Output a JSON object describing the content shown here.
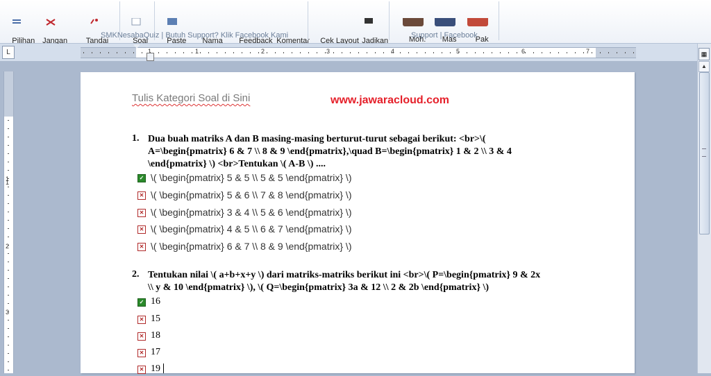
{
  "ribbon": {
    "buttons": [
      {
        "id": "pilihan-ganda",
        "label": "Pilihan\nGanda",
        "icon": "list-icon"
      },
      {
        "id": "jangan-acak-soal",
        "label": "Jangan\nAcak Soal",
        "icon": "no-shuffle-icon"
      },
      {
        "id": "tandai-benar-salah",
        "label": "Tandai\nBenar/Salah",
        "icon": "check-mark-icon"
      },
      {
        "id": "soal-essay",
        "label": "Soal\nEssay",
        "icon": "essay-icon"
      },
      {
        "id": "paste-image",
        "label": "Paste\nImage",
        "icon": "image-icon"
      },
      {
        "id": "nama-pertanyaan",
        "label": "Nama\nPertanyaan",
        "icon": "name-tag-icon"
      },
      {
        "id": "feedback-soal",
        "label": "Feedback\nSoal",
        "icon": "feedback-icon"
      },
      {
        "id": "komentar-soal",
        "label": "Komentar\nSoal",
        "icon": "comment-icon"
      },
      {
        "id": "cek-layout-soal",
        "label": "Cek Layout\nSoal",
        "icon": "layout-check-icon"
      },
      {
        "id": "jadikan-xml",
        "label": "Jadikan\nXML",
        "icon": "xml-icon"
      },
      {
        "id": "moh-shobirin",
        "label": "Moh.\nShobirin",
        "icon": "avatar-icon"
      },
      {
        "id": "mas-pur",
        "label": "Mas\nPur",
        "icon": "avatar-icon"
      },
      {
        "id": "pak-suprino",
        "label": "Pak\nSuprino",
        "icon": "avatar-icon"
      }
    ],
    "group_main_label": "SMKNesabaQuiz | Butuh Support? Klik Facebook Kami",
    "group_support_label": "Support | Facebook"
  },
  "ruler": {
    "tab_selector": "L",
    "h_numbers": [
      "1",
      "1",
      "2",
      "3",
      "4",
      "5",
      "6",
      "7"
    ],
    "v_numbers": [
      "1",
      "1",
      "2",
      "3"
    ]
  },
  "document": {
    "category_title": "Tulis Kategori Soal di Sini",
    "watermark": "www.jawaracloud.com",
    "questions": [
      {
        "number": "1.",
        "lines": [
          "Dua buah matriks A dan B masing-masing berturut-turut sebagai berikut: <br>\\(",
          "A=\\begin{pmatrix} 6 & 7 \\\\ 8 & 9 \\end{pmatrix},\\quad B=\\begin{pmatrix} 1 & 2 \\\\ 3 & 4",
          "\\end{pmatrix} \\) <br>Tentukan \\( A-B \\) ...."
        ],
        "options": [
          {
            "text": "\\( \\begin{pmatrix} 5 & 5 \\\\ 5 & 5 \\end{pmatrix} \\)",
            "correct": true
          },
          {
            "text": "\\( \\begin{pmatrix} 5 & 6 \\\\ 7 & 8 \\end{pmatrix} \\)",
            "correct": false
          },
          {
            "text": "\\( \\begin{pmatrix} 3 & 4 \\\\ 5 & 6 \\end{pmatrix} \\)",
            "correct": false
          },
          {
            "text": "\\( \\begin{pmatrix} 4 & 5 \\\\ 6 & 7 \\end{pmatrix} \\)",
            "correct": false
          },
          {
            "text": "\\( \\begin{pmatrix} 6 & 7 \\\\ 8 & 9 \\end{pmatrix} \\)",
            "correct": false
          }
        ]
      },
      {
        "number": "2.",
        "lines": [
          "Tentukan nilai \\( a+b+x+y \\) dari matriks-matriks berikut ini <br>\\( P=\\begin{pmatrix} 9 & 2x",
          "\\\\ y & 10 \\end{pmatrix} \\),  \\( Q=\\begin{pmatrix} 3a & 12 \\\\ 2 & 2b \\end{pmatrix} \\)"
        ],
        "options": [
          {
            "text": "16",
            "correct": true
          },
          {
            "text": "15",
            "correct": false
          },
          {
            "text": "18",
            "correct": false
          },
          {
            "text": "17",
            "correct": false
          },
          {
            "text": "19",
            "correct": false
          }
        ]
      }
    ]
  }
}
